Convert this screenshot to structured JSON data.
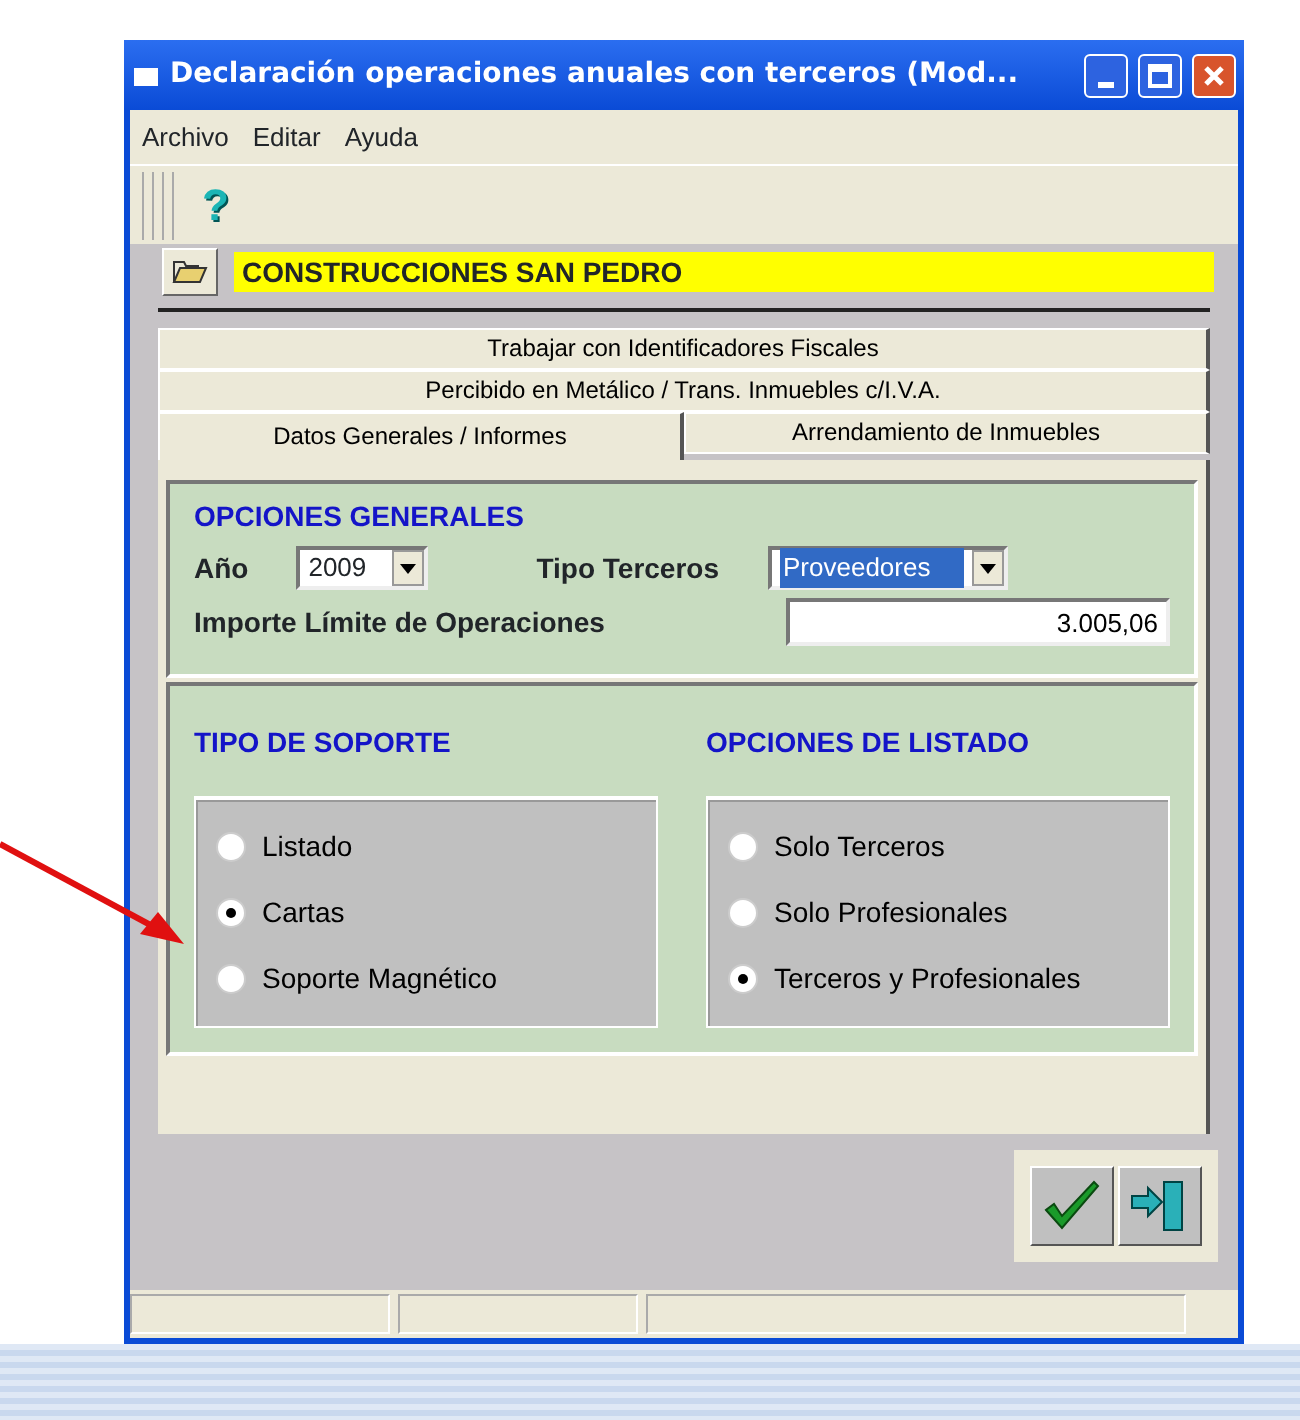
{
  "window": {
    "title": "Declaración operaciones anuales con terceros (Mod..."
  },
  "menu": [
    "Archivo",
    "Editar",
    "Ayuda"
  ],
  "toolbar": {
    "help_glyph": "?"
  },
  "company": {
    "name": "CONSTRUCCIONES SAN PEDRO"
  },
  "tab_rows": [
    {
      "tabs": [
        {
          "label": "Trabajar con Identificadores Fiscales",
          "selected": false
        }
      ]
    },
    {
      "tabs": [
        {
          "label": "Percibido en Metálico / Trans. Inmuebles c/I.V.A.",
          "selected": false
        }
      ]
    },
    {
      "tabs": [
        {
          "label": "Datos Generales / Informes",
          "selected": true
        },
        {
          "label": "Arrendamiento de Inmuebles",
          "selected": false
        }
      ]
    }
  ],
  "opciones_generales": {
    "title": "OPCIONES GENERALES",
    "year_label": "Año",
    "year": "2009",
    "tipo_label": "Tipo Terceros",
    "tipo": "Proveedores",
    "importe_label": "Importe Límite de Operaciones",
    "importe": "3.005,06"
  },
  "groups": [
    {
      "title": "TIPO DE SOPORTE",
      "options": [
        {
          "label": "Listado",
          "selected": false
        },
        {
          "label": "Cartas",
          "selected": true
        },
        {
          "label": "Soporte Magnético",
          "selected": false
        }
      ]
    },
    {
      "title": "OPCIONES DE LISTADO",
      "options": [
        {
          "label": "Solo Terceros",
          "selected": false
        },
        {
          "label": "Solo Profesionales",
          "selected": false
        },
        {
          "label": "Terceros y Profesionales",
          "selected": true
        }
      ]
    }
  ]
}
